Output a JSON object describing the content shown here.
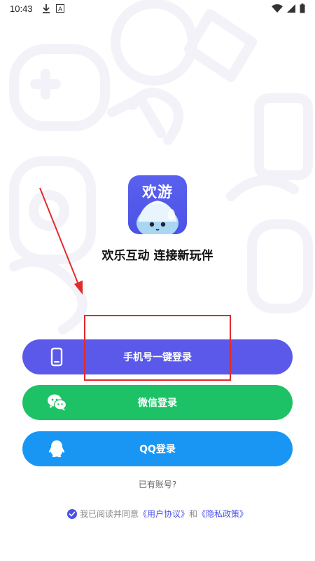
{
  "status_bar": {
    "time": "10:43",
    "icons": [
      "download-icon",
      "font-icon",
      "wifi-icon",
      "signal-icon",
      "battery-icon"
    ]
  },
  "app": {
    "logo_text": "欢游",
    "tagline": "欢乐互动 连接新玩伴"
  },
  "login": {
    "phone_label": "手机号一键登录",
    "wechat_label": "微信登录",
    "qq_label": "QQ登录",
    "has_account": "已有账号?"
  },
  "agreement": {
    "prefix": "我已阅读并同意",
    "user_agreement": "《用户协议》",
    "and": "和",
    "privacy_policy": "《隐私政策》"
  },
  "colors": {
    "brand": "#5a59ea",
    "wechat": "#1dc266",
    "qq": "#1996f4",
    "annotation": "#e12b2b"
  }
}
